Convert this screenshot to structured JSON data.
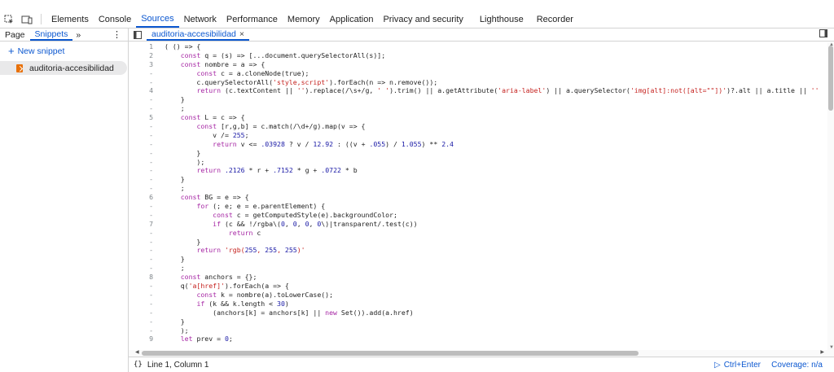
{
  "toolbar": {
    "inspect_icon": "inspect-element-icon",
    "device_icon": "device-toolbar-icon",
    "tabs": [
      "Elements",
      "Console",
      "Sources",
      "Network",
      "Performance",
      "Memory",
      "Application",
      "Privacy and security",
      "Lighthouse",
      "Recorder"
    ],
    "active_tab": "Sources"
  },
  "sidebar": {
    "tabs": [
      "Page",
      "Snippets"
    ],
    "more": "»",
    "kebab": "⋮",
    "new_snippet_label": "New snippet",
    "items": [
      {
        "label": "auditoria-accesibilidad"
      }
    ]
  },
  "editor": {
    "file_tab": "auditoria-accesibilidad",
    "close": "×"
  },
  "code": [
    {
      "n": "1",
      "t": "( () => {"
    },
    {
      "n": "2",
      "t": "    const q = (s) => [...document.querySelectorAll(s)];"
    },
    {
      "n": "3",
      "t": "    const nombre = a => {"
    },
    {
      "n": "-",
      "t": "        const c = a.cloneNode(true);"
    },
    {
      "n": "-",
      "t": "        c.querySelectorAll('style,script').forEach(n => n.remove());"
    },
    {
      "n": "4",
      "t": "        return (c.textContent || '').replace(/\\s+/g, ' ').trim() || a.getAttribute('aria-label') || a.querySelector('img[alt]:not([alt=\"\"])')?.alt || a.title || ''"
    },
    {
      "n": "-",
      "t": "    }"
    },
    {
      "n": "-",
      "t": "    ;"
    },
    {
      "n": "5",
      "t": "    const L = c => {"
    },
    {
      "n": "-",
      "t": "        const [r,g,b] = c.match(/\\d+/g).map(v => {"
    },
    {
      "n": "-",
      "t": "            v /= 255;"
    },
    {
      "n": "-",
      "t": "            return v <= .03928 ? v / 12.92 : ((v + .055) / 1.055) ** 2.4"
    },
    {
      "n": "-",
      "t": "        }"
    },
    {
      "n": "-",
      "t": "        );"
    },
    {
      "n": "-",
      "t": "        return .2126 * r + .7152 * g + .0722 * b"
    },
    {
      "n": "-",
      "t": "    }"
    },
    {
      "n": "-",
      "t": "    ;"
    },
    {
      "n": "6",
      "t": "    const BG = e => {"
    },
    {
      "n": "-",
      "t": "        for (; e; e = e.parentElement) {"
    },
    {
      "n": "-",
      "t": "            const c = getComputedStyle(e).backgroundColor;"
    },
    {
      "n": "7",
      "t": "            if (c && !/rgba\\(0, 0, 0, 0\\)|transparent/.test(c))"
    },
    {
      "n": "-",
      "t": "                return c"
    },
    {
      "n": "-",
      "t": "        }"
    },
    {
      "n": "-",
      "t": "        return 'rgb(255, 255, 255)'"
    },
    {
      "n": "-",
      "t": "    }"
    },
    {
      "n": "-",
      "t": "    ;"
    },
    {
      "n": "8",
      "t": "    const anchors = {};"
    },
    {
      "n": "-",
      "t": "    q('a[href]').forEach(a => {"
    },
    {
      "n": "-",
      "t": "        const k = nombre(a).toLowerCase();"
    },
    {
      "n": "-",
      "t": "        if (k && k.length < 30)"
    },
    {
      "n": "-",
      "t": "            (anchors[k] = anchors[k] || new Set()).add(a.href)"
    },
    {
      "n": "-",
      "t": "    }"
    },
    {
      "n": "-",
      "t": "    );"
    },
    {
      "n": "9",
      "t": "    let prev = 0;"
    }
  ],
  "status": {
    "brace": "{}",
    "position": "Line 1, Column 1",
    "run": "Ctrl+Enter",
    "coverage": "Coverage: n/a"
  }
}
